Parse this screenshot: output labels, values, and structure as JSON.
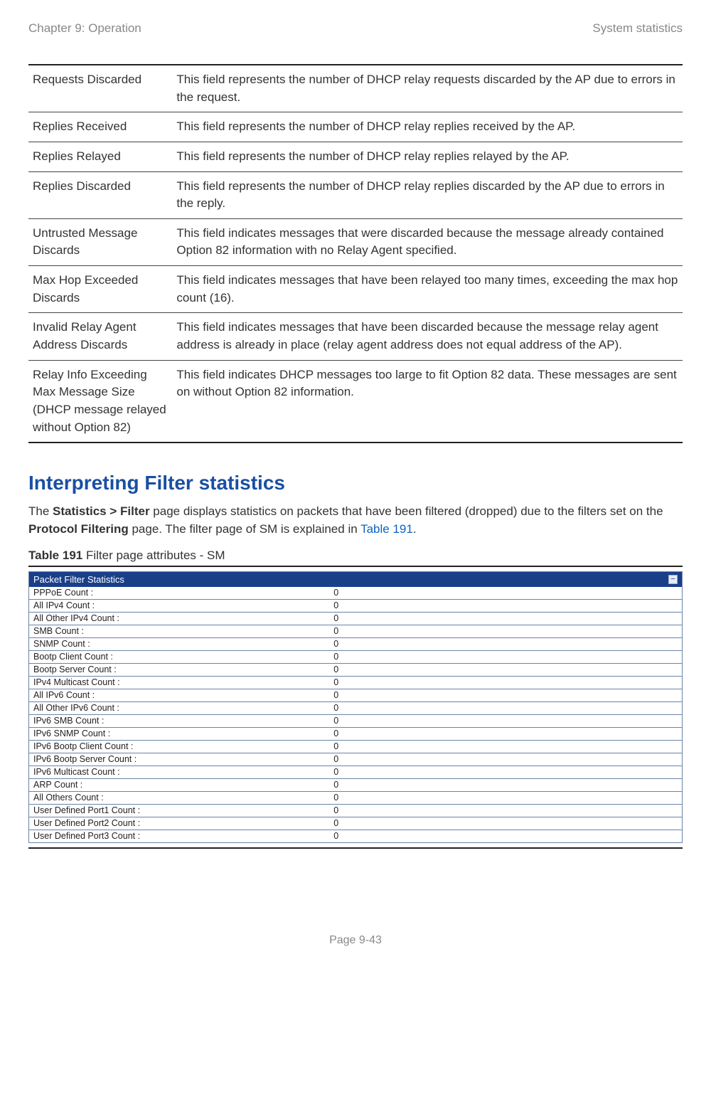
{
  "header": {
    "left": "Chapter 9:  Operation",
    "right": "System statistics"
  },
  "definitions": [
    {
      "term": "Requests Discarded",
      "desc": "This field represents the number of DHCP relay requests discarded by the AP due to errors in the request."
    },
    {
      "term": "Replies Received",
      "desc": "This field represents the number of DHCP relay replies received by the AP."
    },
    {
      "term": "Replies Relayed",
      "desc": "This field represents the number of DHCP relay replies relayed by the AP."
    },
    {
      "term": "Replies Discarded",
      "desc": "This field represents the number of DHCP relay replies discarded by the AP due to errors in the reply."
    },
    {
      "term": "Untrusted Message Discards",
      "desc": "This field indicates messages that were discarded because the message already contained Option 82 information with no Relay Agent specified."
    },
    {
      "term": "Max Hop Exceeded Discards",
      "desc": "This field indicates messages that have been relayed too many times, exceeding the max hop count (16)."
    },
    {
      "term": "Invalid Relay Agent Address Discards",
      "desc": "This field indicates messages that have been discarded because the message relay agent address is already in place (relay agent address does not equal address of the AP)."
    },
    {
      "term": "Relay Info Exceeding Max Message Size (DHCP message relayed without Option 82)",
      "desc": "This field indicates DHCP messages too large to fit Option 82 data. These messages are sent on without Option 82 information."
    }
  ],
  "section_title": "Interpreting Filter statistics",
  "body": {
    "pre": "The ",
    "bold1": "Statistics > Filter",
    "mid1": " page displays statistics on packets that have been filtered (dropped) due to the filters set on the ",
    "bold2": "Protocol Filtering",
    "mid2": " page. The filter page of SM is explained in ",
    "link": "Table 191",
    "post": "."
  },
  "caption": {
    "bold": "Table 191",
    "rest": " Filter page attributes - SM"
  },
  "panel_title": "Packet Filter Statistics",
  "stats": [
    {
      "label": "PPPoE Count :",
      "value": "0"
    },
    {
      "label": "All IPv4 Count :",
      "value": "0"
    },
    {
      "label": "All Other IPv4 Count :",
      "value": "0"
    },
    {
      "label": "SMB Count :",
      "value": "0"
    },
    {
      "label": "SNMP Count :",
      "value": "0"
    },
    {
      "label": "Bootp Client Count :",
      "value": "0"
    },
    {
      "label": "Bootp Server Count :",
      "value": "0"
    },
    {
      "label": "IPv4 Multicast Count :",
      "value": "0"
    },
    {
      "label": "All IPv6 Count :",
      "value": "0"
    },
    {
      "label": "All Other IPv6 Count :",
      "value": "0"
    },
    {
      "label": "IPv6 SMB Count :",
      "value": "0"
    },
    {
      "label": "IPv6 SNMP Count :",
      "value": "0"
    },
    {
      "label": "IPv6 Bootp Client Count :",
      "value": "0"
    },
    {
      "label": "IPv6 Bootp Server Count :",
      "value": "0"
    },
    {
      "label": "IPv6 Multicast Count :",
      "value": "0"
    },
    {
      "label": "ARP Count :",
      "value": "0"
    },
    {
      "label": "All Others Count :",
      "value": "0"
    },
    {
      "label": "User Defined Port1 Count :",
      "value": "0"
    },
    {
      "label": "User Defined Port2 Count :",
      "value": "0"
    },
    {
      "label": "User Defined Port3 Count :",
      "value": "0"
    }
  ],
  "footer": "Page 9-43"
}
